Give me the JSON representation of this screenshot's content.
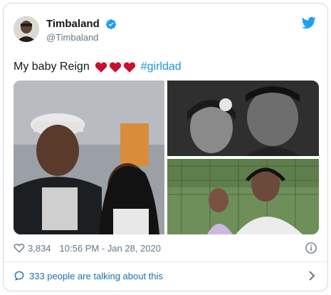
{
  "tweet": {
    "author_name": "Timbaland",
    "author_handle": "@Timbaland",
    "text_prefix": "My baby Reign",
    "hashtag": "#girldad",
    "heart_emoji_count": 3,
    "likes": "3,834",
    "timestamp": "10:56 PM - Jan 28, 2020"
  },
  "footer": {
    "talk_text": "333 people are talking about this"
  },
  "colors": {
    "twitter_blue": "#1da1f2",
    "hashtag": "#1b95e0",
    "heart": "#c8102e",
    "muted": "#657786"
  },
  "icons": {
    "verified": "verified-badge-icon",
    "bird": "twitter-bird-icon",
    "like": "heart-outline-icon",
    "info": "info-icon",
    "talk": "speech-bubble-icon",
    "chevron": "chevron-right-icon"
  }
}
